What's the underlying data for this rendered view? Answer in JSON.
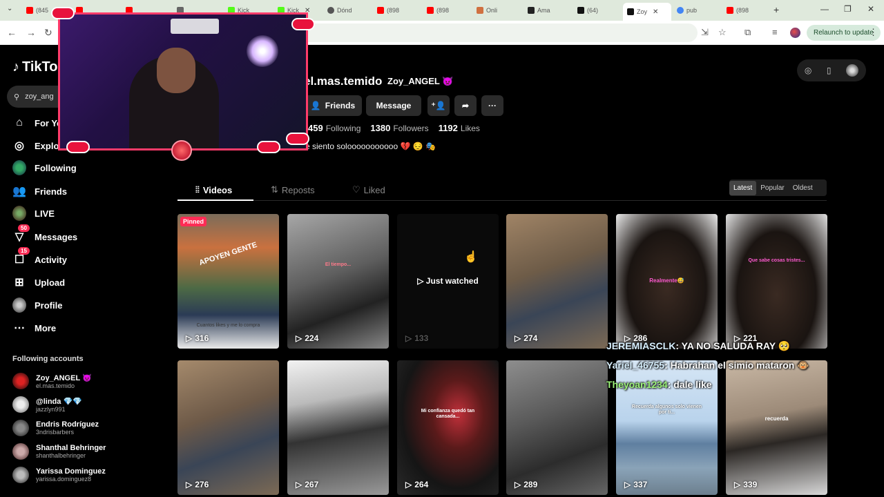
{
  "browser": {
    "tabs": [
      {
        "label": "(845",
        "icon": "youtube-icon",
        "color": "#ff0000"
      },
      {
        "label": "",
        "icon": "youtube-icon",
        "color": "#ff0000"
      },
      {
        "label": "",
        "icon": "youtube-icon",
        "color": "#ff0000"
      },
      {
        "label": "",
        "icon": "site-icon",
        "color": "#666666"
      },
      {
        "label": "Kick",
        "icon": "kick-icon",
        "color": "#53fc18"
      },
      {
        "label": "Kick",
        "icon": "kick-icon",
        "color": "#53fc18"
      },
      {
        "label": "Dónd",
        "icon": "globe-icon",
        "color": "#555555"
      },
      {
        "label": "(898",
        "icon": "youtube-icon",
        "color": "#ff0000"
      },
      {
        "label": "(898",
        "icon": "youtube-icon",
        "color": "#ff0000"
      },
      {
        "label": "Onli",
        "icon": "calendar-icon",
        "color": "#d07040"
      },
      {
        "label": "Ama",
        "icon": "amazon-icon",
        "color": "#222222"
      },
      {
        "label": "(64)",
        "icon": "tiktok-icon",
        "color": "#111111"
      },
      {
        "label": "Zoy",
        "icon": "tiktok-icon",
        "color": "#111111"
      },
      {
        "label": "pub",
        "icon": "google-icon",
        "color": "#4285f4"
      },
      {
        "label": "(898",
        "icon": "youtube-icon",
        "color": "#ff0000"
      }
    ],
    "relaunch_label": "Relaunch to update"
  },
  "sidebar": {
    "logo": "TikTo",
    "search_value": "zoy_ang",
    "nav": [
      {
        "label": "For Yo",
        "icon": "home-icon"
      },
      {
        "label": "Explo",
        "icon": "compass-icon"
      },
      {
        "label": "Following",
        "icon": "following-avatar"
      },
      {
        "label": "Friends",
        "icon": "friends-icon"
      },
      {
        "label": "LIVE",
        "icon": "live-avatar"
      },
      {
        "label": "Messages",
        "icon": "messages-icon",
        "badge": "50"
      },
      {
        "label": "Activity",
        "icon": "activity-icon",
        "badge": "15"
      },
      {
        "label": "Upload",
        "icon": "upload-icon"
      },
      {
        "label": "Profile",
        "icon": "profile-avatar"
      },
      {
        "label": "More",
        "icon": "more-icon"
      }
    ],
    "following_title": "Following accounts",
    "accounts": [
      {
        "name": "Zoy_ANGEL 👿",
        "user": "el.mas.temido"
      },
      {
        "name": "@linda 💎💎",
        "user": "jazzlyn991"
      },
      {
        "name": "Endris Rodríguez",
        "user": "3ndrisbarbers"
      },
      {
        "name": "Shanthal Behringer",
        "user": "shanthalbehringer"
      },
      {
        "name": "Yarissa Dominguez",
        "user": "yarissa.dominguez8"
      }
    ]
  },
  "profile": {
    "username": "el.mas.temido",
    "nickname": "Zoy_ANGEL 👿",
    "friends_label": "Friends",
    "message_label": "Message",
    "following_count": "459",
    "following_label": "Following",
    "followers_count": "1380",
    "followers_label": "Followers",
    "likes_count": "1192",
    "likes_label": "Likes",
    "bio": "e siento solooooooooooo 💔 😔 🎭"
  },
  "tabs": {
    "videos": "Videos",
    "reposts": "Reposts",
    "liked": "Liked"
  },
  "sort": {
    "latest": "Latest",
    "popular": "Popular",
    "oldest": "Oldest"
  },
  "videos": [
    {
      "views": "316",
      "pinned": "Pinned",
      "caption": "APOYEN GENTE",
      "sub": "Cuantos likes y me lo compra"
    },
    {
      "views": "224",
      "caption": "El tiempo..."
    },
    {
      "views": "133",
      "just_watched": "Just watched"
    },
    {
      "views": "274",
      "caption": ""
    },
    {
      "views": "286",
      "caption": "Realmente😅"
    },
    {
      "views": "221",
      "caption": "Que sabe cosas tristes..."
    },
    {
      "views": "276",
      "caption": ""
    },
    {
      "views": "267",
      "caption": ""
    },
    {
      "views": "264",
      "caption": "Mi confianza quedó tan cansada..."
    },
    {
      "views": "289",
      "caption": ""
    },
    {
      "views": "337",
      "caption": "Recuerda algunos solo vienen por ti..."
    },
    {
      "views": "339",
      "caption": "recuerda"
    }
  ],
  "chat": [
    {
      "user": "JEREMIASCLK",
      "msg": ": YA NO SALUDA RAY 🥺"
    },
    {
      "user": "Yariel_46755",
      "msg": ": Habrahan el simio mataron 🐵"
    },
    {
      "user": "Theyoan1234",
      "msg": ": dale like"
    }
  ],
  "colors": {
    "accent": "#fe2c55",
    "cam_border": "#ff3b6a"
  }
}
